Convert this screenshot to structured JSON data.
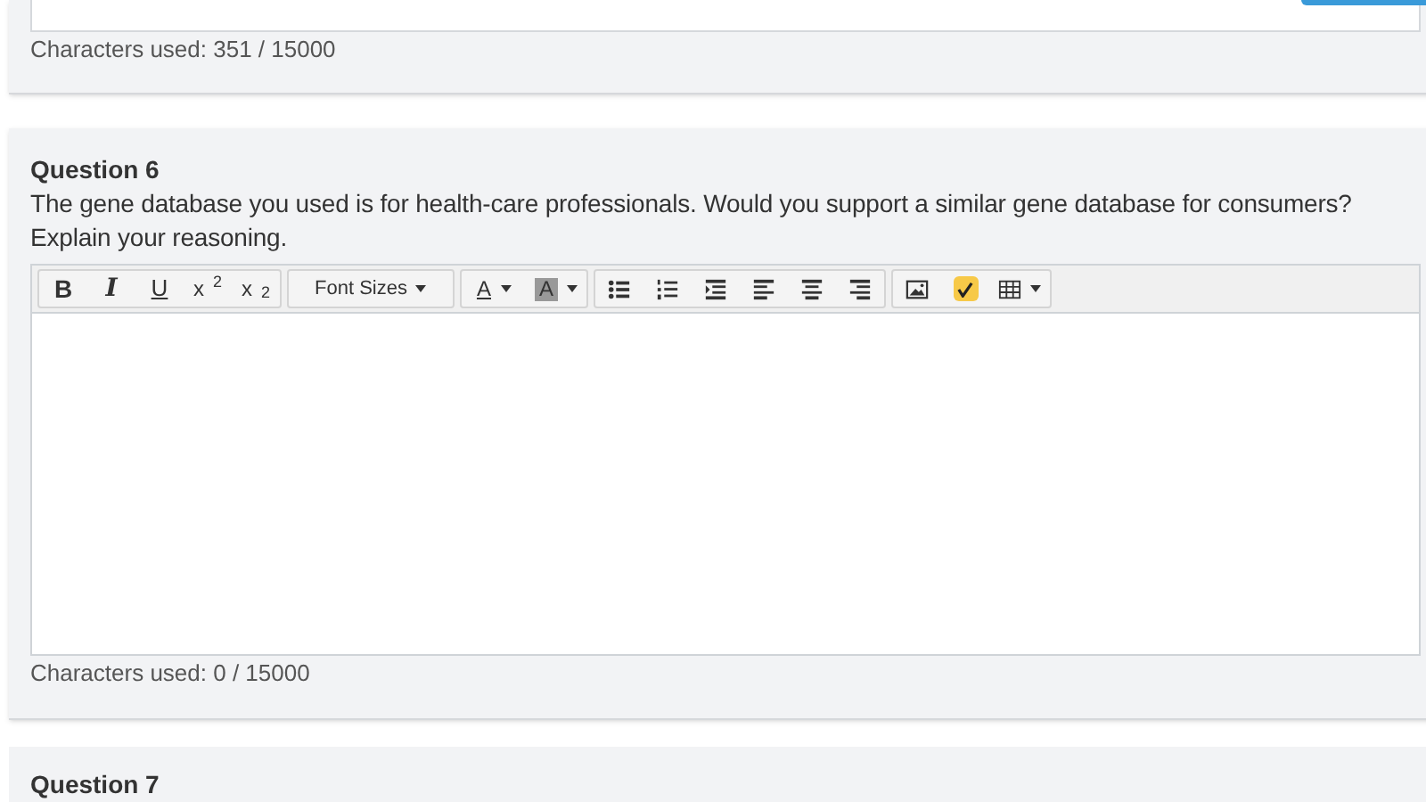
{
  "previous_question": {
    "counter": "Characters used: 351 / 15000"
  },
  "question": {
    "title": "Question 6",
    "prompt": "The gene database you used is for health-care professionals. Would you support a similar gene database for consumers? Explain your reasoning.",
    "toolbar": [
      {
        "buttons": [
          {
            "kind": "bold",
            "label": "B"
          },
          {
            "kind": "italic",
            "label": "I"
          },
          {
            "kind": "underline",
            "label": "U"
          },
          {
            "kind": "superscript",
            "label": "x$^{2}$"
          },
          {
            "kind": "subscript",
            "label": "x$_{2}$"
          }
        ]
      },
      {
        "buttons": [
          {
            "kind": "select",
            "label": "Font Sizes"
          }
        ]
      },
      {
        "buttons": [
          {
            "kind": "text-color",
            "label": "A"
          },
          {
            "kind": "highlight-color",
            "label": "A"
          }
        ]
      },
      {
        "buttons": [
          {
            "kind": "bullet-list"
          },
          {
            "kind": "numbered-list"
          },
          {
            "kind": "indent"
          },
          {
            "kind": "align-left"
          },
          {
            "kind": "align-center"
          },
          {
            "kind": "align-right"
          }
        ]
      },
      {
        "buttons": [
          {
            "kind": "image"
          },
          {
            "kind": "formula"
          },
          {
            "kind": "table"
          }
        ]
      }
    ],
    "counter": "Characters used: 0 / 15000"
  },
  "next_question": {
    "title": "Question 7"
  }
}
